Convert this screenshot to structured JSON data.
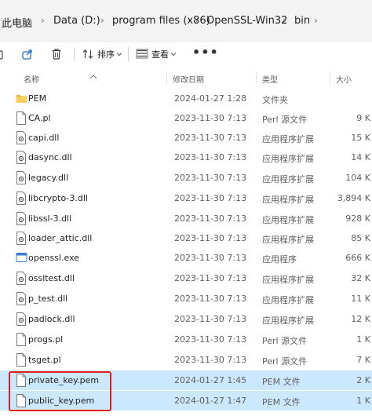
{
  "breadcrumb": {
    "items": [
      "此电脑",
      "Data (D:)",
      "program files (x86)",
      "OpenSSL-Win32",
      "bin"
    ],
    "separator": "›"
  },
  "toolbar": {
    "sort_label": "排序",
    "view_label": "查看",
    "more_label": "•••"
  },
  "columns": {
    "name": "名称",
    "date": "修改日期",
    "type": "类型",
    "size": "大小"
  },
  "files": [
    {
      "name": "PEM",
      "date": "2024-01-27 1:28",
      "type": "文件夹",
      "size": "",
      "icon": "folder-icon"
    },
    {
      "name": "CA.pl",
      "date": "2023-11-30 7:13",
      "type": "Perl 源文件",
      "size": "9 K",
      "icon": "file-icon"
    },
    {
      "name": "capi.dll",
      "date": "2023-11-30 7:13",
      "type": "应用程序扩展",
      "size": "15 K",
      "icon": "dll-icon"
    },
    {
      "name": "dasync.dll",
      "date": "2023-11-30 7:13",
      "type": "应用程序扩展",
      "size": "14 K",
      "icon": "dll-icon"
    },
    {
      "name": "legacy.dll",
      "date": "2023-11-30 7:13",
      "type": "应用程序扩展",
      "size": "104 K",
      "icon": "dll-icon"
    },
    {
      "name": "libcrypto-3.dll",
      "date": "2023-11-30 7:13",
      "type": "应用程序扩展",
      "size": "3,894 K",
      "icon": "dll-icon"
    },
    {
      "name": "libssl-3.dll",
      "date": "2023-11-30 7:13",
      "type": "应用程序扩展",
      "size": "928 K",
      "icon": "dll-icon"
    },
    {
      "name": "loader_attic.dll",
      "date": "2023-11-30 7:13",
      "type": "应用程序扩展",
      "size": "85 K",
      "icon": "dll-icon"
    },
    {
      "name": "openssl.exe",
      "date": "2023-11-30 7:13",
      "type": "应用程序",
      "size": "666 K",
      "icon": "exe-icon"
    },
    {
      "name": "ossltest.dll",
      "date": "2023-11-30 7:13",
      "type": "应用程序扩展",
      "size": "32 K",
      "icon": "dll-icon"
    },
    {
      "name": "p_test.dll",
      "date": "2023-11-30 7:13",
      "type": "应用程序扩展",
      "size": "11 K",
      "icon": "dll-icon"
    },
    {
      "name": "padlock.dll",
      "date": "2023-11-30 7:13",
      "type": "应用程序扩展",
      "size": "12 K",
      "icon": "dll-icon"
    },
    {
      "name": "progs.pl",
      "date": "2023-11-30 7:13",
      "type": "Perl 源文件",
      "size": "1 K",
      "icon": "file-icon"
    },
    {
      "name": "tsget.pl",
      "date": "2023-11-30 7:13",
      "type": "Perl 源文件",
      "size": "7 K",
      "icon": "file-icon"
    },
    {
      "name": "private_key.pem",
      "date": "2024-01-27 1:45",
      "type": "PEM 文件",
      "size": "2 K",
      "icon": "file-icon",
      "selected": true
    },
    {
      "name": "public_key.pem",
      "date": "2024-01-27 1:47",
      "type": "PEM 文件",
      "size": "1 K",
      "icon": "file-icon",
      "selected": true
    }
  ],
  "colors": {
    "selection": "#cce8ff",
    "highlight_border": "#e01e1e",
    "folder": "#e8b84a",
    "breadcrumb_bg": "#f3f3f3"
  }
}
